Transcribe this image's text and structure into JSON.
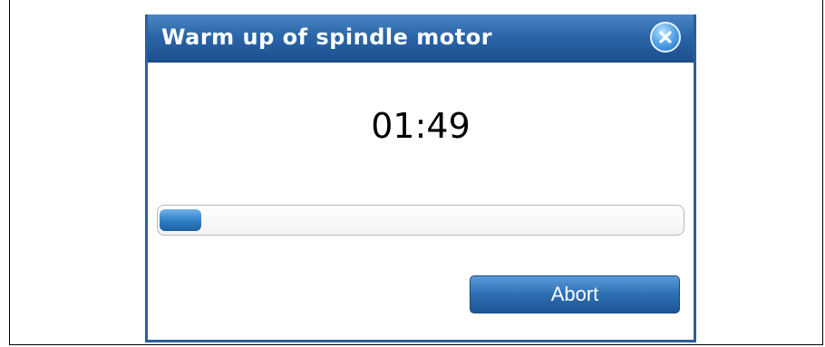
{
  "dialog": {
    "title": "Warm up of spindle motor",
    "timer": "01:49",
    "progress_fraction": 0.08,
    "abort_label": "Abort"
  },
  "icons": {
    "close": "close-icon"
  },
  "colors": {
    "titlebar": "#2b66a8",
    "progress_fill": "#2f7dc4",
    "button": "#2d6fb4"
  }
}
